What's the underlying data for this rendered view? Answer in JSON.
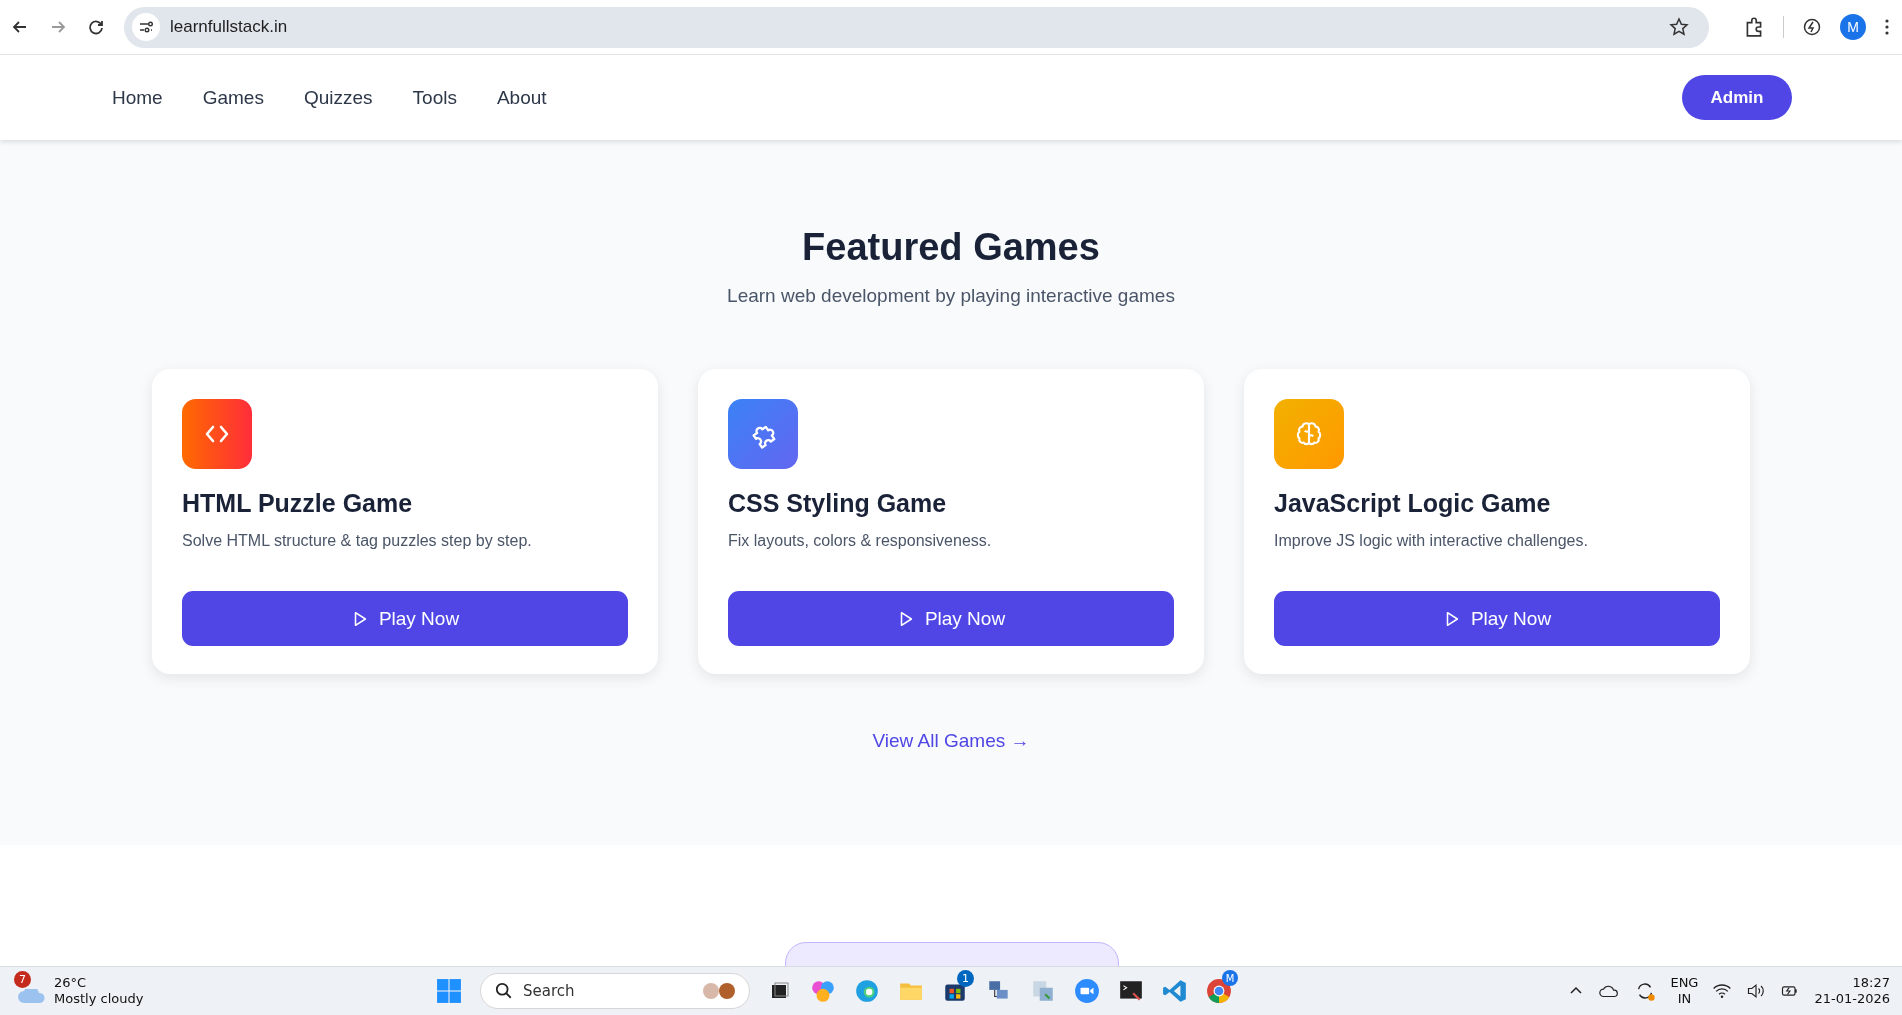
{
  "browser": {
    "url": "learnfullstack.in",
    "profile_initial": "M"
  },
  "nav": {
    "links": [
      {
        "label": "Home"
      },
      {
        "label": "Games"
      },
      {
        "label": "Quizzes"
      },
      {
        "label": "Tools"
      },
      {
        "label": "About"
      }
    ],
    "admin_button": "Admin"
  },
  "featured": {
    "title": "Featured Games",
    "subtitle": "Learn web development by playing interactive games",
    "games": [
      {
        "kind": "code",
        "title": "HTML Puzzle Game",
        "description": "Solve HTML structure & tag puzzles step by step.",
        "button": "Play Now"
      },
      {
        "kind": "puzzle",
        "title": "CSS Styling Game",
        "description": "Fix layouts, colors & responsiveness.",
        "button": "Play Now"
      },
      {
        "kind": "brain",
        "title": "JavaScript Logic Game",
        "description": "Improve JS logic with interactive challenges.",
        "button": "Play Now"
      }
    ],
    "view_all": "View All Games →"
  },
  "taskbar": {
    "weather_badge": "7",
    "temperature": "26°C",
    "condition": "Mostly cloudy",
    "search_placeholder": "Search",
    "store_badge": "1",
    "chrome_badge": "M",
    "language": "ENG",
    "region": "IN",
    "time": "18:27",
    "date": "21-01-2026"
  }
}
